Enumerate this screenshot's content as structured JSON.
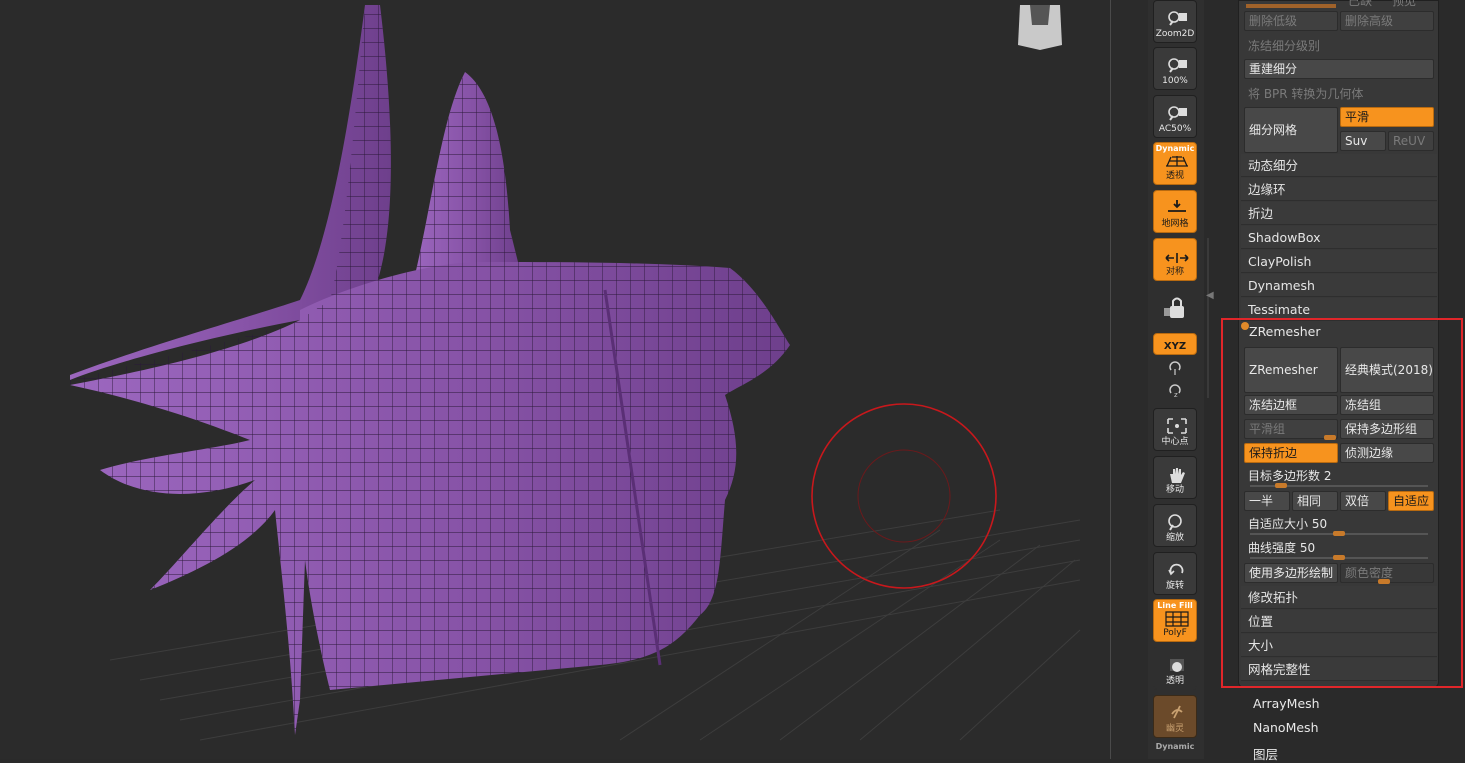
{
  "shelf": {
    "zoom2d": "Zoom2D",
    "pct100": "100%",
    "ac50": "AC50%",
    "dynamic": "Dynamic",
    "persp": "透视",
    "floor": "地网格",
    "sym": "对称",
    "xyz": "XYZ",
    "center": "中心点",
    "move": "移动",
    "scale": "缩放",
    "rotate": "旋转",
    "linefill": "Line Fill",
    "polyf": "PolyF",
    "transp": "透明",
    "ghost": "幽灵",
    "dynamic2": "Dynamic"
  },
  "subdiv": {
    "top_a": "已缺",
    "top_b": "预见",
    "del_lower": "删除低级",
    "del_higher": "删除高级",
    "freeze": "冻结细分级别",
    "rebuild": "重建细分",
    "bpr": "将 BPR 转换为几何体",
    "divide": "细分网格",
    "smooth": "平滑",
    "suv": "Suv",
    "reuv": "ReUV"
  },
  "menu": [
    "动态细分",
    "边缘环",
    "折边",
    "ShadowBox",
    "ClayPolish",
    "Dynamesh",
    "Tessimate"
  ],
  "zremesher": {
    "header": "ZRemesher",
    "btn_main": "ZRemesher",
    "btn_classic": "经典模式(2018)",
    "freeze_border": "冻结边框",
    "freeze_groups": "冻结组",
    "smooth_groups": "平滑组",
    "keep_polygroups": "保持多边形组",
    "keep_creases": "保持折边",
    "detect_edges": "侦测边缘",
    "target_label": "目标多边形数",
    "target_value": "2",
    "target_level": 0.15,
    "half": "一半",
    "same": "相同",
    "double": "双倍",
    "adapt": "自适应",
    "adapt_size_label": "自适应大小",
    "adapt_size_value": "50",
    "adapt_size_level": 0.5,
    "curve_label": "曲线强度",
    "curve_value": "50",
    "curve_level": 0.5,
    "use_polypaint": "使用多边形绘制",
    "color_density": "颜色密度",
    "after": [
      "修改拓扑",
      "位置",
      "大小",
      "网格完整性"
    ]
  },
  "bottom": [
    "ArrayMesh",
    "NanoMesh",
    "图层"
  ],
  "colors": {
    "accent": "#f7931e",
    "mesh": "#8a55a8",
    "highlight": "#e0262a"
  }
}
